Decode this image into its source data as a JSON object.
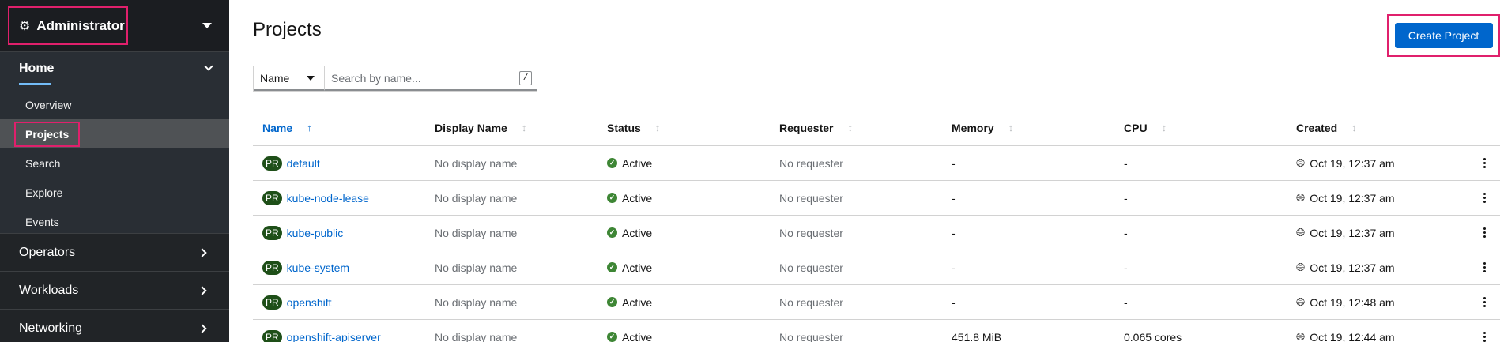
{
  "sidebar": {
    "perspective": {
      "label": "Administrator",
      "icon": "cogs-icon"
    },
    "home": {
      "label": "Home",
      "items": [
        {
          "label": "Overview"
        },
        {
          "label": "Projects",
          "active": true
        },
        {
          "label": "Search"
        },
        {
          "label": "Explore"
        },
        {
          "label": "Events"
        }
      ]
    },
    "sections": [
      {
        "label": "Operators"
      },
      {
        "label": "Workloads"
      },
      {
        "label": "Networking"
      }
    ]
  },
  "main": {
    "title": "Projects",
    "create_button": "Create Project",
    "filter": {
      "selected": "Name",
      "placeholder": "Search by name...",
      "shortcut": "/"
    },
    "table": {
      "columns": [
        "Name",
        "Display Name",
        "Status",
        "Requester",
        "Memory",
        "CPU",
        "Created"
      ],
      "sorted_column": "Name",
      "rows": [
        {
          "badge": "PR",
          "name": "default",
          "display_name": "No display name",
          "status": "Active",
          "requester": "No requester",
          "memory": "-",
          "cpu": "-",
          "created": "Oct 19, 12:37 am"
        },
        {
          "badge": "PR",
          "name": "kube-node-lease",
          "display_name": "No display name",
          "status": "Active",
          "requester": "No requester",
          "memory": "-",
          "cpu": "-",
          "created": "Oct 19, 12:37 am"
        },
        {
          "badge": "PR",
          "name": "kube-public",
          "display_name": "No display name",
          "status": "Active",
          "requester": "No requester",
          "memory": "-",
          "cpu": "-",
          "created": "Oct 19, 12:37 am"
        },
        {
          "badge": "PR",
          "name": "kube-system",
          "display_name": "No display name",
          "status": "Active",
          "requester": "No requester",
          "memory": "-",
          "cpu": "-",
          "created": "Oct 19, 12:37 am"
        },
        {
          "badge": "PR",
          "name": "openshift",
          "display_name": "No display name",
          "status": "Active",
          "requester": "No requester",
          "memory": "-",
          "cpu": "-",
          "created": "Oct 19, 12:48 am"
        },
        {
          "badge": "PR",
          "name": "openshift-apiserver",
          "display_name": "No display name",
          "status": "Active",
          "requester": "No requester",
          "memory": "451.8 MiB",
          "cpu": "0.065 cores",
          "created": "Oct 19, 12:44 am"
        }
      ]
    }
  },
  "colors": {
    "accent": "#0066cc",
    "highlight": "#e0206c",
    "sidebar_bg": "#212427",
    "badge_bg": "#1e4f18",
    "status_ok": "#3e8635"
  }
}
